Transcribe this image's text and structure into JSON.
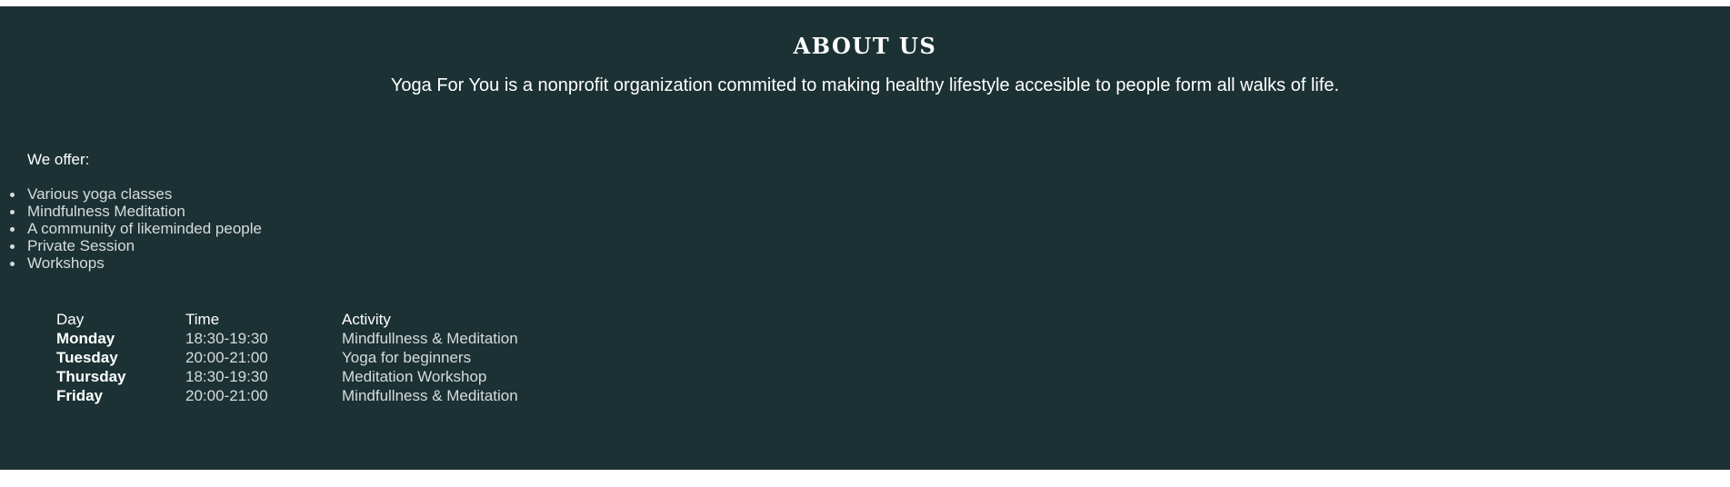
{
  "about": {
    "title": "ABOUT US",
    "description": "Yoga For You is a nonprofit organization commited to making healthy lifestyle accesible to people form all walks of life."
  },
  "offer": {
    "heading": "We offer:",
    "items": [
      "Various yoga classes",
      "Mindfulness Meditation",
      "A community of likeminded people",
      "Private Session",
      "Workshops"
    ]
  },
  "schedule": {
    "headers": {
      "day": "Day",
      "time": "Time",
      "activity": "Activity"
    },
    "rows": [
      {
        "day": "Monday",
        "time": "18:30-19:30",
        "activity": "Mindfullness & Meditation"
      },
      {
        "day": "Tuesday",
        "time": "20:00-21:00",
        "activity": "Yoga for beginners"
      },
      {
        "day": "Thursday",
        "time": "18:30-19:30",
        "activity": "Meditation Workshop"
      },
      {
        "day": "Friday",
        "time": "20:00-21:00",
        "activity": "Mindfullness & Meditation"
      }
    ]
  },
  "colors": {
    "section_background": "#1c3133",
    "text_primary": "#ffffff",
    "text_secondary": "#d6dcdc"
  }
}
